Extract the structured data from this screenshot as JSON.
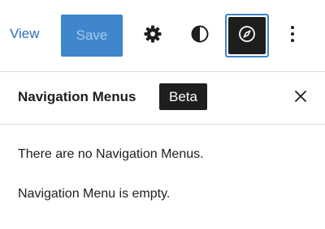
{
  "toolbar": {
    "view_label": "View",
    "save_label": "Save",
    "icons": {
      "settings": "gear-icon",
      "styles": "half-circle-contrast-icon",
      "navigation": "compass-icon",
      "options": "vertical-ellipsis-icon"
    }
  },
  "panel": {
    "title": "Navigation Menus",
    "badge": "Beta",
    "close_icon": "close-icon",
    "messages": [
      "There are no Navigation Menus.",
      "Navigation Menu is empty."
    ]
  },
  "colors": {
    "accent": "#3f86cc",
    "link": "#2e6fb5",
    "dark": "#1e1e1e",
    "divider": "#dcdcde"
  }
}
